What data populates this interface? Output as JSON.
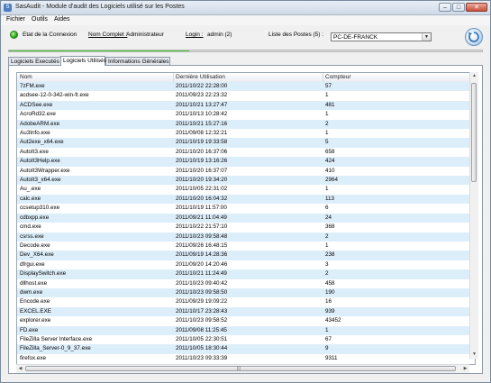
{
  "window": {
    "title": "SasAudit - Module d'audit des Logiciels utilisé sur les Postes",
    "icon_name": "app-icon",
    "controls": {
      "minimize": "–",
      "maximize": "□",
      "close": "✕"
    }
  },
  "menu": {
    "items": [
      "Fichier",
      "Outils",
      "Aides"
    ]
  },
  "header": {
    "connection_label": "Etat de la Connexion",
    "user_label": "Nom Complet :",
    "user_value": "Administrateur",
    "login_label": "Login :",
    "login_value": "admin (2)",
    "stations_label": "Liste des Postes (5) :",
    "selected_station": "PC-DE-FRANCK",
    "status_color": "#2fa81a",
    "refresh_icon": "refresh-icon"
  },
  "progress": {
    "value": 0.38
  },
  "tabs": [
    {
      "label": "Logiciels Executés",
      "active": false
    },
    {
      "label": "Logiciels Utilisés",
      "active": true
    },
    {
      "label": "Informations Générales",
      "active": false
    }
  ],
  "table": {
    "columns": [
      "Nom",
      "Dernière Utilisation",
      "Compteur"
    ],
    "rows": [
      [
        "7zFM.exe",
        "2011/10/22 22:28:00",
        "57"
      ],
      [
        "acdsee-12-0-342-win-fr.exe",
        "2011/09/23 22:23:32",
        "1"
      ],
      [
        "ACDSee.exe",
        "2011/10/21 13:27:47",
        "481"
      ],
      [
        "AcroRd32.exe",
        "2011/10/13 10:28:42",
        "1"
      ],
      [
        "AdobeARM.exe",
        "2011/10/21 15:27:16",
        "2"
      ],
      [
        "Au3Info.exe",
        "2011/09/08 12:32:21",
        "1"
      ],
      [
        "Aut2exe_x64.exe",
        "2011/10/19 19:33:58",
        "5"
      ],
      [
        "AutoIt3.exe",
        "2011/10/20 16:37:06",
        "658"
      ],
      [
        "AutoIt3Help.exe",
        "2011/10/19 13:16:26",
        "424"
      ],
      [
        "AutoIt3Wrapper.exe",
        "2011/10/20 16:37:07",
        "410"
      ],
      [
        "AutoIt3_x64.exe",
        "2011/10/20 19:34:20",
        "2964"
      ],
      [
        "Au_.exe",
        "2011/10/05 22:31:02",
        "1"
      ],
      [
        "calc.exe",
        "2011/10/20 16:04:32",
        "113"
      ],
      [
        "ccsetup310.exe",
        "2011/10/19 11:57:00",
        "6"
      ],
      [
        "cdbxpp.exe",
        "2011/09/21 11:04:49",
        "24"
      ],
      [
        "cmd.exe",
        "2011/10/22 21:57:10",
        "368"
      ],
      [
        "csrss.exe",
        "2011/10/23 09:58:48",
        "2"
      ],
      [
        "Decode.exe",
        "2011/09/26 16:48:15",
        "1"
      ],
      [
        "Dev_X64.exe",
        "2011/09/19 14:28:36",
        "238"
      ],
      [
        "dfrgui.exe",
        "2011/09/20 14:20:46",
        "3"
      ],
      [
        "DisplaySwitch.exe",
        "2011/10/21 11:24:49",
        "2"
      ],
      [
        "dllhost.exe",
        "2011/10/23 09:40:42",
        "458"
      ],
      [
        "dwm.exe",
        "2011/10/23 09:58:50",
        "190"
      ],
      [
        "Encode.exe",
        "2011/09/29 19:09:22",
        "16"
      ],
      [
        "EXCEL.EXE",
        "2011/10/17 23:28:43",
        "939"
      ],
      [
        "explorer.exe",
        "2011/10/23 09:58:52",
        "43452"
      ],
      [
        "FD.exe",
        "2011/09/08 11:25:45",
        "1"
      ],
      [
        "FileZilla Server Interface.exe",
        "2011/10/05 22:30:51",
        "67"
      ],
      [
        "FileZilla_Server-0_9_37.exe",
        "2011/10/05 18:30:44",
        "9"
      ],
      [
        "firefox.exe",
        "2011/10/23 09:33:39",
        "9311"
      ]
    ]
  }
}
